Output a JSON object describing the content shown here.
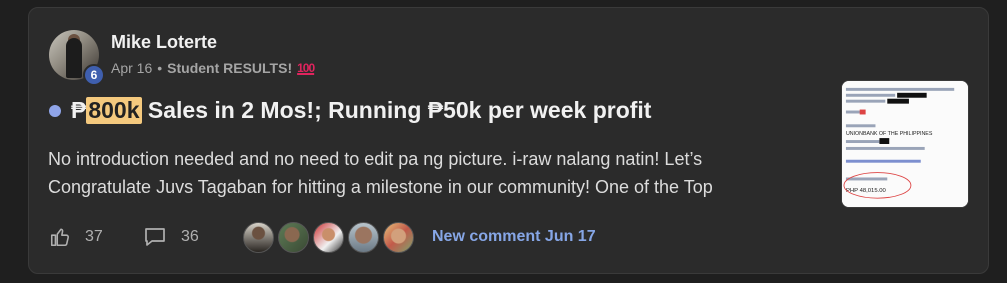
{
  "post": {
    "author": "Mike Loterte",
    "level": "6",
    "date": "Apr 16",
    "separator": "•",
    "category": "Student RESULTS!",
    "category_emoji": "100",
    "title_prefix": "₱",
    "title_highlight": "800k",
    "title_rest": " Sales in 2 Mos!; Running ₱50k per week profit",
    "body": "No introduction needed and no need to edit pa ng picture. i-raw nalang natin! Let’s Congratulate Juvs Tagaban for hitting a milestone in our community! One of the Top"
  },
  "footer": {
    "likes": "37",
    "comments": "36",
    "new_comment": "New comment Jun 17"
  },
  "colors": {
    "background": "#1f1f1f",
    "card": "#2b2b2b",
    "accent_link": "#86a6e6",
    "highlight": "#f4c97e",
    "level_badge": "#3f5fae",
    "unread_dot": "#8fa4e8"
  },
  "thumbnail": {
    "bank": "UNIONBANK OF THE PHILIPPINES",
    "amount": "PHP 48,015.00"
  }
}
